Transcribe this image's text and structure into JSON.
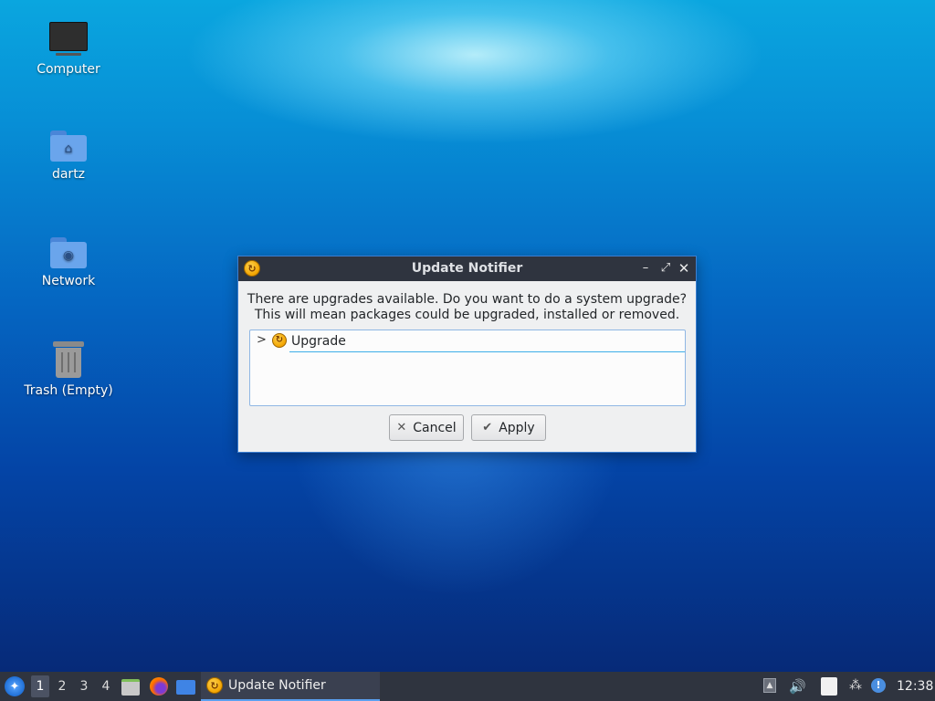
{
  "desktop_icons": [
    {
      "label": "Computer",
      "icon": "computer-icon"
    },
    {
      "label": "dartz",
      "icon": "home-folder-icon"
    },
    {
      "label": "Network",
      "icon": "network-folder-icon"
    },
    {
      "label": "Trash (Empty)",
      "icon": "trash-icon"
    }
  ],
  "dialog": {
    "title": "Update Notifier",
    "message_line1": "There are upgrades available. Do you want to do a system upgrade?",
    "message_line2": "This will mean packages could be upgraded, installed or removed.",
    "tree_item": "Upgrade",
    "cancel_label": "Cancel",
    "apply_label": "Apply"
  },
  "taskbar": {
    "workspaces": [
      "1",
      "2",
      "3",
      "4"
    ],
    "active_workspace": "1",
    "task_label": "Update Notifier",
    "clock": "12:38"
  },
  "colors": {
    "titlebar": "#2f343f",
    "taskbar": "#2f343f",
    "dialog_bg": "#eff0f1",
    "accent": "#3daee9"
  }
}
